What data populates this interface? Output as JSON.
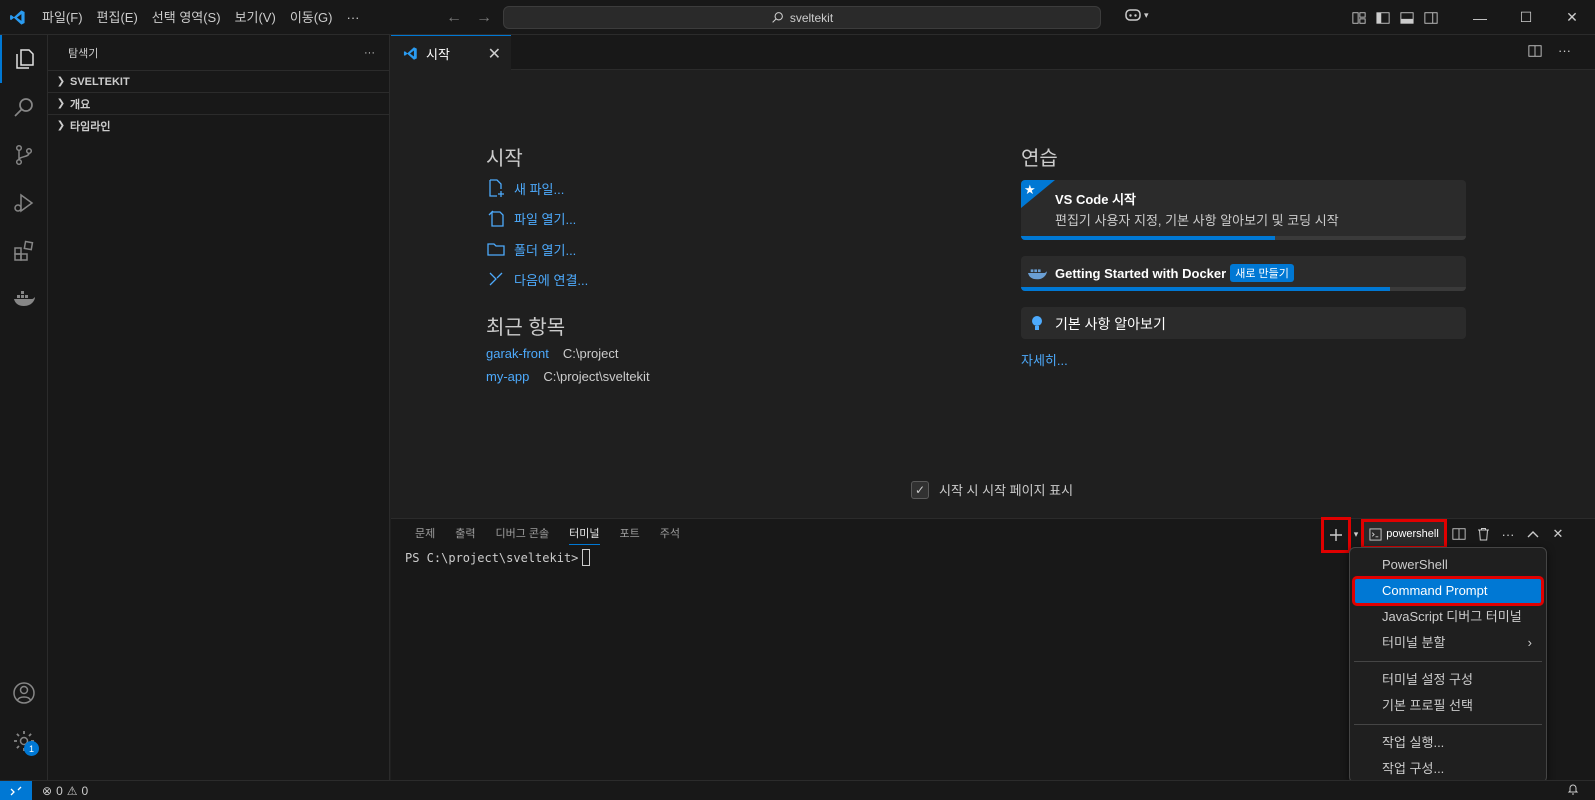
{
  "titlebar": {
    "menu": [
      "파일(F)",
      "편집(E)",
      "선택 영역(S)",
      "보기(V)",
      "이동(G)",
      "···"
    ],
    "search_text": "sveltekit"
  },
  "sidebar": {
    "title": "탐색기",
    "more": "···",
    "sections": [
      "SVELTEKIT",
      "개요",
      "타임라인"
    ]
  },
  "editor": {
    "tab_label": "시작"
  },
  "welcome": {
    "start_title": "시작",
    "start_links": [
      "새 파일...",
      "파일 열기...",
      "폴더 열기...",
      "다음에 연결..."
    ],
    "recent_title": "최근 항목",
    "recent": [
      {
        "name": "garak-front",
        "path": "C:\\project"
      },
      {
        "name": "my-app",
        "path": "C:\\project\\sveltekit"
      }
    ],
    "walkthrough_title": "연습",
    "cards": [
      {
        "title": "VS Code 시작",
        "desc": "편집기 사용자 지정, 기본 사항 알아보기 및 코딩 시작",
        "progress": 0.57
      },
      {
        "title": "Getting Started with Docker",
        "badge": "새로 만들기",
        "progress": 0.83
      },
      {
        "title": "기본 사항 알아보기"
      }
    ],
    "more_link": "자세히...",
    "startup_label": "시작 시 시작 페이지 표시"
  },
  "panel": {
    "tabs": [
      "문제",
      "출력",
      "디버그 콘솔",
      "터미널",
      "포트",
      "주석"
    ],
    "active_tab": "터미널",
    "terminal_prompt": "PS C:\\project\\sveltekit>",
    "shell_label": "powershell"
  },
  "dropdown": {
    "group1": [
      "PowerShell",
      "Command Prompt",
      "JavaScript 디버그 터미널",
      "터미널 분할"
    ],
    "selected": "Command Prompt",
    "group2": [
      "터미널 설정 구성",
      "기본 프로필 선택"
    ],
    "group3": [
      "작업 실행...",
      "작업 구성..."
    ]
  },
  "statusbar": {
    "errors": "0",
    "warnings": "0"
  },
  "activity": {
    "settings_badge": "1"
  },
  "colors": {
    "accent": "#0078d4",
    "link": "#4daafc",
    "highlight": "#e00000"
  }
}
